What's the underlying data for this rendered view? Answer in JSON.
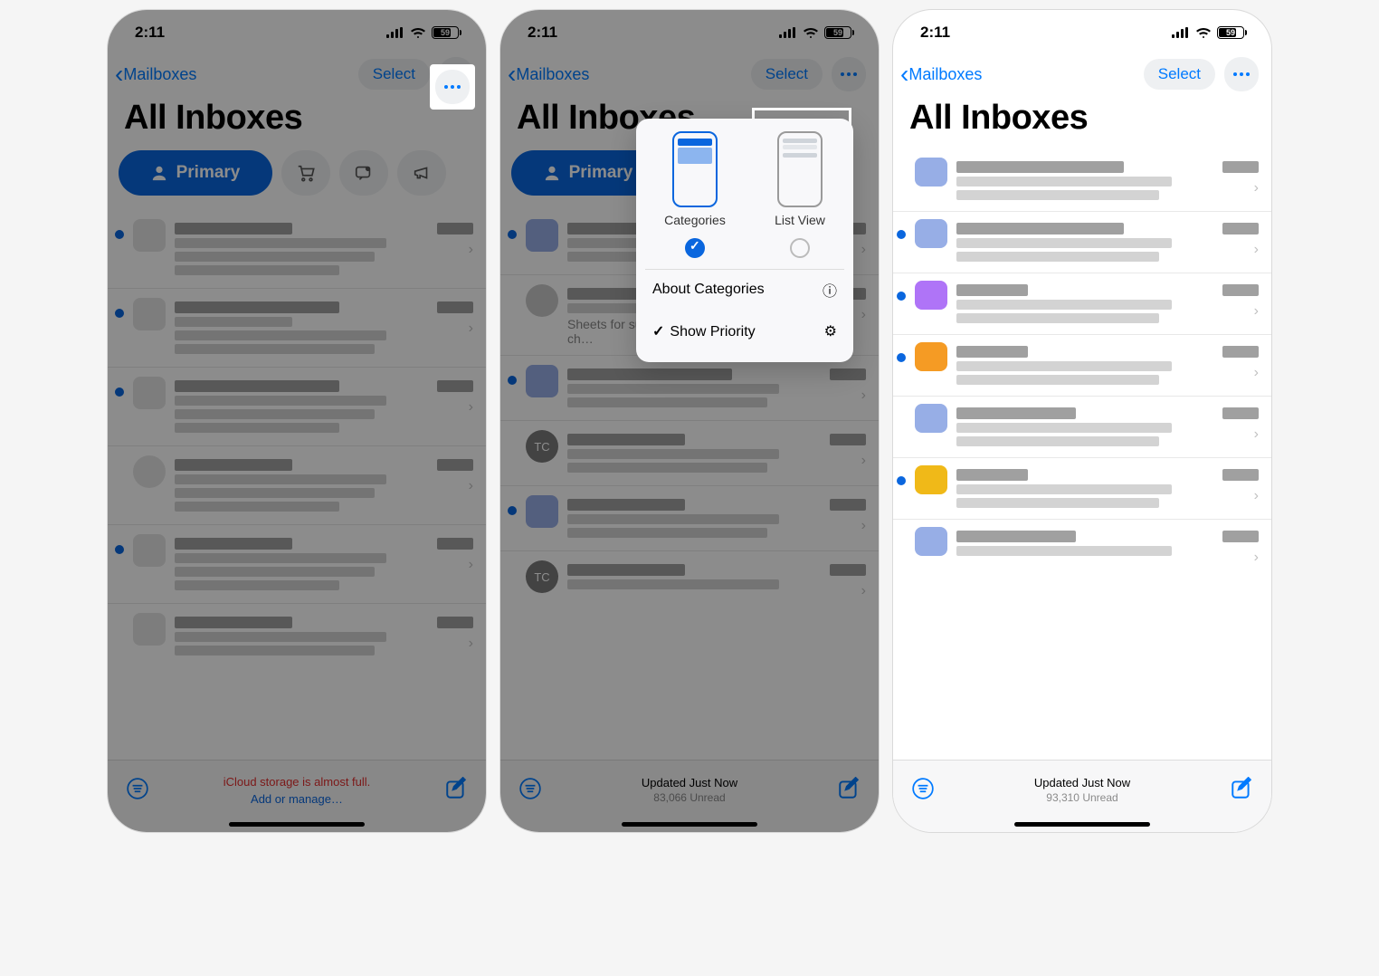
{
  "status": {
    "time": "2:11",
    "battery": "59"
  },
  "nav": {
    "back_label": "Mailboxes",
    "select_label": "Select"
  },
  "title": "All Inboxes",
  "chips": {
    "primary": "Primary"
  },
  "popover": {
    "categories_label": "Categories",
    "listview_label": "List View",
    "about_label": "About Categories",
    "priority_label": "Show Priority"
  },
  "bottom2": {
    "line1": "Updated Just Now",
    "line2": "83,066 Unread"
  },
  "bottom1": {
    "line1": "iCloud storage is almost full.",
    "line2": "Add or manage…"
  },
  "bottom3": {
    "line1": "Updated Just Now",
    "line2": "93,310 Unread"
  },
  "snippet_s2": "Sheets for subscribers; free with an SEO ch…"
}
